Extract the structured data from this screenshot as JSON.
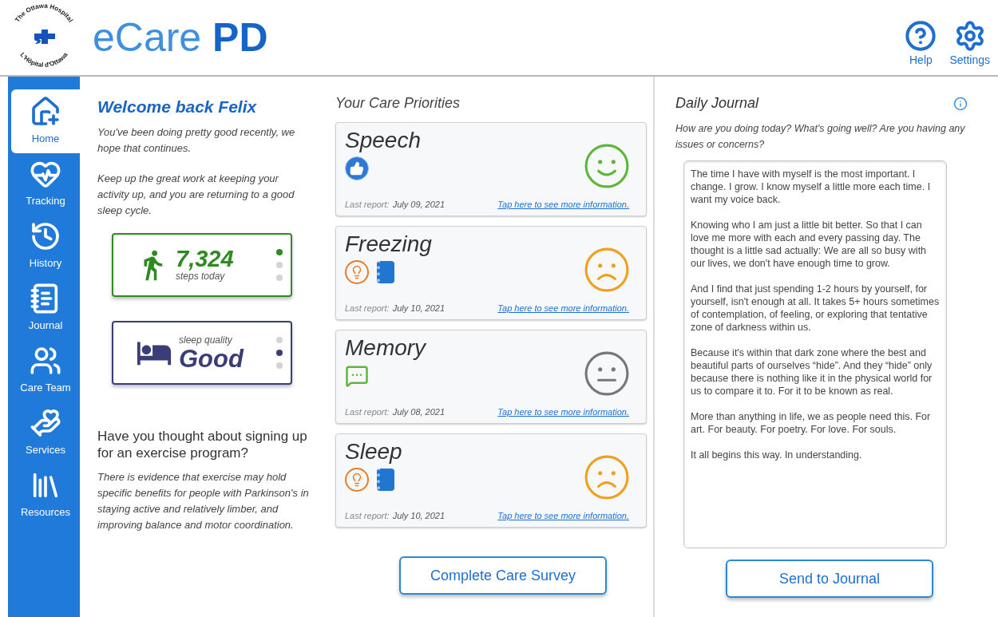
{
  "header": {
    "logo_top": "The Ottawa Hospital",
    "logo_bottom": "L'Hôpital d'Ottawa",
    "app_title": "eCare **PD**",
    "actions": [
      {
        "kind": "help",
        "label": "Help"
      },
      {
        "kind": "settings",
        "label": "Settings"
      }
    ]
  },
  "sidebar": {
    "items": [
      {
        "kind": "home",
        "label": "Home",
        "selected": true
      },
      {
        "kind": "tracking",
        "label": "Tracking",
        "selected": false
      },
      {
        "kind": "history",
        "label": "History",
        "selected": false
      },
      {
        "kind": "journal",
        "label": "Journal",
        "selected": false
      },
      {
        "kind": "team",
        "label": "Care Team",
        "selected": false
      },
      {
        "kind": "services",
        "label": "Services",
        "selected": false
      },
      {
        "kind": "resources",
        "label": "Resources",
        "selected": false
      }
    ]
  },
  "welcome": {
    "title": "Welcome back Felix",
    "paragraphs": [
      "You've been doing pretty good recently, we hope that continues.",
      "Keep up the great work at keeping your activity up, and you are returning to a good sleep cycle."
    ]
  },
  "stats": [
    {
      "kind": "steps",
      "value": "7,324",
      "caption": "steps today",
      "color": "#2f8a1f",
      "dots": [
        {
          "selected": true
        },
        {
          "selected": false
        },
        {
          "selected": false
        }
      ]
    },
    {
      "kind": "sleep",
      "value": "Good",
      "caption": "sleep quality",
      "color": "#3b3d78",
      "dots": [
        {
          "selected": false
        },
        {
          "selected": true
        },
        {
          "selected": false
        }
      ]
    }
  ],
  "suggestion": {
    "title": "Have you thought about signing up for an exercise program?",
    "body": "There is evidence that exercise may hold specific benefits for people with Parkinson's in staying active and relatively limber, and improving balance and motor coordination."
  },
  "priorities": {
    "title": "Your Care Priorities",
    "items": [
      {
        "name": "Speech",
        "icons": [
          {
            "kind": "thumbs"
          }
        ],
        "face": {
          "kind": "happy"
        },
        "report_label": "Last report:",
        "report_date": "July 09, 2021",
        "link": "Tap here to see more information."
      },
      {
        "name": "Freezing",
        "icons": [
          {
            "kind": "tip"
          },
          {
            "kind": "notebook"
          }
        ],
        "face": {
          "kind": "sad"
        },
        "report_label": "Last report:",
        "report_date": "July 10, 2021",
        "link": "Tap here to see more information."
      },
      {
        "name": "Memory",
        "icons": [
          {
            "kind": "chat"
          }
        ],
        "face": {
          "kind": "neutral"
        },
        "report_label": "Last report:",
        "report_date": "July 08, 2021",
        "link": "Tap here to see more information."
      },
      {
        "name": "Sleep",
        "icons": [
          {
            "kind": "tip"
          },
          {
            "kind": "notebook"
          }
        ],
        "face": {
          "kind": "sad"
        },
        "report_label": "Last report:",
        "report_date": "July 10, 2021",
        "link": "Tap here to see more information."
      }
    ]
  },
  "survey_button": "Complete Care Survey",
  "journal": {
    "title": "Daily Journal",
    "prompt": "How are you doing today? What's going well? Are you having any issues or concerns?",
    "value": "The time I have with myself is the most important. I change. I grow. I know myself a little more each time. I want my voice back.\n\nKnowing who I am just a little bit better. So that I can love me more with each and every passing day. The thought is a little sad actually: We are all so busy with our lives, we don't have enough time to grow.\n\nAnd I find that just spending 1-2 hours by yourself, for yourself, isn't enough at all. It takes 5+ hours sometimes of contemplation, of feeling, or exploring that tentative zone of darkness within us.\n\nBecause it's within that dark zone where the best and beautiful parts of ourselves “hide”. And they “hide” only because there is nothing like it in the physical world for us to compare it to. For it to be known as real.\n\nMore than anything in life, we as people need this. For art. For beauty. For poetry. For love. For souls.\n\nIt all begins this way. In understanding.",
    "button": "Send to Journal"
  }
}
